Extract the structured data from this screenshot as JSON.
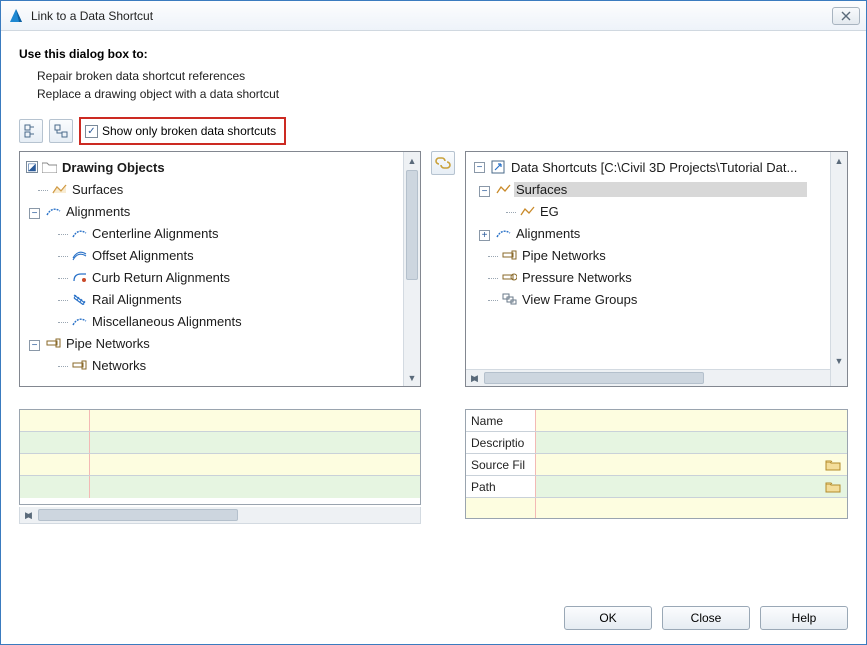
{
  "title": "Link to a Data Shortcut",
  "use_heading": "Use this dialog box to:",
  "use_lines": [
    "Repair broken data shortcut references",
    "Replace a drawing object with a data shortcut"
  ],
  "filter_label": "Show only broken data shortcuts",
  "filter_checked": true,
  "left_tree": {
    "root": "Drawing Objects",
    "nodes": [
      {
        "label": "Surfaces",
        "depth": 1,
        "expander": null,
        "icon": "surface"
      },
      {
        "label": "Alignments",
        "depth": 1,
        "expander": "minus",
        "icon": "align"
      },
      {
        "label": "Centerline Alignments",
        "depth": 2,
        "expander": null,
        "icon": "align"
      },
      {
        "label": "Offset Alignments",
        "depth": 2,
        "expander": null,
        "icon": "align-offset"
      },
      {
        "label": "Curb Return Alignments",
        "depth": 2,
        "expander": null,
        "icon": "align-curb"
      },
      {
        "label": "Rail Alignments",
        "depth": 2,
        "expander": null,
        "icon": "align-rail"
      },
      {
        "label": "Miscellaneous Alignments",
        "depth": 2,
        "expander": null,
        "icon": "align"
      },
      {
        "label": "Pipe Networks",
        "depth": 1,
        "expander": "minus",
        "icon": "pipe"
      },
      {
        "label": "Networks",
        "depth": 2,
        "expander": null,
        "icon": "pipe"
      }
    ]
  },
  "right_tree": {
    "root": "Data Shortcuts [C:\\Civil 3D Projects\\Tutorial Dat...",
    "nodes": [
      {
        "label": "Surfaces",
        "depth": 1,
        "expander": "minus",
        "icon": "surface",
        "selected": true
      },
      {
        "label": "EG",
        "depth": 2,
        "expander": null,
        "icon": "surface"
      },
      {
        "label": "Alignments",
        "depth": 1,
        "expander": "plus",
        "icon": "align"
      },
      {
        "label": "Pipe Networks",
        "depth": 1,
        "expander": null,
        "icon": "pipe"
      },
      {
        "label": "Pressure Networks",
        "depth": 1,
        "expander": null,
        "icon": "pipe"
      },
      {
        "label": "View Frame Groups",
        "depth": 1,
        "expander": null,
        "icon": "viewframe"
      }
    ]
  },
  "props": {
    "r1": "Name",
    "r2": "Descriptio",
    "r3": "Source Fil",
    "r4": "Path"
  },
  "buttons": {
    "ok": "OK",
    "close": "Close",
    "help": "Help"
  }
}
